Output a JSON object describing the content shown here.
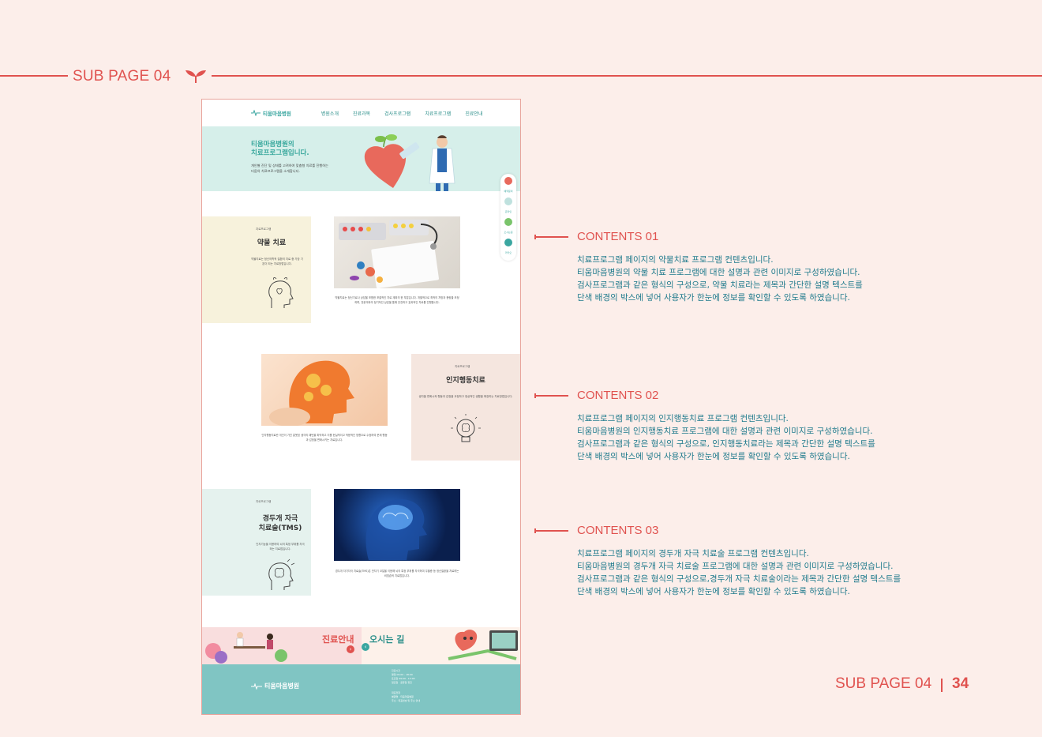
{
  "header": {
    "title": "SUB PAGE 04"
  },
  "mockup": {
    "nav": {
      "logo": "티움마음병원",
      "menu": [
        "병원소개",
        "진료과목",
        "검사프로그램",
        "치료프로그램",
        "진료안내"
      ]
    },
    "hero": {
      "title_line1": "티움마음병원의",
      "title_line2": "치료프로그램입니다.",
      "desc_line1": "개인별 진단 및 상태를 고려하여 맞춤형 치료를 진행하는",
      "desc_line2": "티움의 치료프로그램을 소개합니다."
    },
    "sidebar": [
      "예약문의",
      "온라인",
      "오시는길",
      "카카오"
    ],
    "sections": [
      {
        "caption": "치료프로그램",
        "title": "약물 치료",
        "desc": "약물치료는 정신의학적 질환의 치료 중 가장 기본이 되는 치료방법입니다.",
        "body": "약물치료는 정신기료나 상담을 포함한 포괄적인 치료 계획의 한 부분입니다. 개별적으로 최적의 처방과 용량을 조정하며, 전문의와의 정기적인 상담을 통해 안전하고 효과적인 치료를 진행합니다."
      },
      {
        "caption": "치료프로그램",
        "title": "인지행동치료",
        "desc": "생각을 변화시켜 행동과 감정을 교정하고 정상적인 생활을 확장하는 치료방법입니다.",
        "body": "인지행동치료란 개인이 가진 잘못된 생각의 패턴을 파악하고 이를 현실적이고 적응적인 방향으로 수정하여 문제 행동과 감정을 변화시키는 치료입니다."
      },
      {
        "caption": "치료프로그램",
        "title_line1": "경두개 자극",
        "title_line2": "치료술(TMS)",
        "desc": "인지기능을 이용하여 뇌의 특정 부위를 자극하는 치료법입니다.",
        "body": "경두개 자기자극 치료술(TMS)은 전자기 코일을 이용해 뇌의 특정 부위를 자극하여 우울증 등 정신질환을 치료하는 비침습적 치료법입니다."
      }
    ],
    "bottom": {
      "left_label": "진료안내",
      "right_label": "오시는 길"
    },
    "footer": {
      "logo": "티움마음병원",
      "info_title": "진료시간",
      "info_lines": [
        "평일 09:00 - 18:00",
        "토요일 09:00 - 13:00",
        "일요일 · 공휴일 휴진"
      ],
      "contact_title": "대표전화",
      "contact_lines": [
        "병원명 : 티움마음병원",
        "주소 : 대표번호 및 주소 안내"
      ]
    }
  },
  "contents": [
    {
      "title": "CONTENTS 01",
      "lines": [
        "치료프로그램 페이지의 약물치료 프로그램 컨텐츠입니다.",
        "티움마음병원의 약물 치료 프로그램에 대한 설명과 관련 이미지로 구성하였습니다.",
        "검사프로그램과 같은 형식의 구성으로, 약물 치료라는 제목과 간단한 설명 텍스트를",
        "단색 배경의 박스에 넣어 사용자가 한눈에 정보를 확인할 수 있도록 하였습니다."
      ]
    },
    {
      "title": "CONTENTS 02",
      "lines": [
        "치료프로그램 페이지의 인지행동치료 프로그램 컨텐츠입니다.",
        "티움마음병원의 인지행동치료 프로그램에 대한 설명과 관련 이미지로 구성하였습니다.",
        "검사프로그램과 같은 형식의 구성으로, 인지행동치료라는 제목과 간단한 설명 텍스트를",
        "단색 배경의 박스에 넣어 사용자가 한눈에 정보를 확인할 수 있도록 하였습니다."
      ]
    },
    {
      "title": "CONTENTS 03",
      "lines": [
        "치료프로그램 페이지의 경두개 자극 치료술 프로그램 컨텐츠입니다.",
        "티움마음병원의 경두개 자극 치료술 프로그램에 대한 설명과 관련 이미지로 구성하였습니다.",
        "검사프로그램과 같은 형식의 구성으로,경두개 자극 치료술이라는 제목과 간단한 설명 텍스트를",
        "단색 배경의 박스에 넣어 사용자가 한눈에 정보를 확인할 수 있도록 하였습니다."
      ]
    }
  ],
  "page_footer": {
    "label": "SUB PAGE  04",
    "number": "34"
  },
  "colors": {
    "accent": "#e0524f",
    "teal": "#1f7a8c",
    "mint": "#d6efea"
  }
}
